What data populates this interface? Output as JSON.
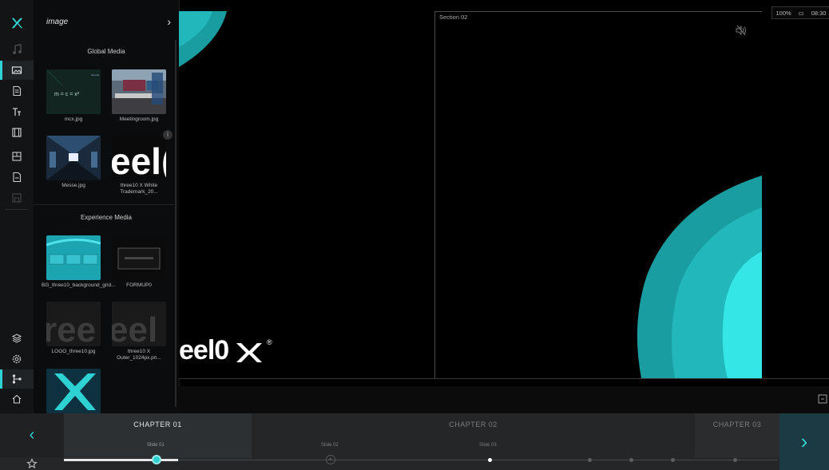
{
  "rail": {
    "logo": "x-logo",
    "icons": [
      "music-icon",
      "image-icon",
      "document-icon",
      "text-icon",
      "video-icon",
      "layout-icon",
      "file-icon",
      "save-icon"
    ],
    "bottom_icons": [
      "layers-icon",
      "settings-icon",
      "flow-icon",
      "home-icon"
    ]
  },
  "panel": {
    "title": "image",
    "global_title": "Global Media",
    "global_items": [
      {
        "label": "mcx.jpg"
      },
      {
        "label": "Meetingroom.jpg"
      },
      {
        "label": "Messe.jpg"
      },
      {
        "label": "three10 X White Trademark_20..."
      }
    ],
    "experience_title": "Experience Media",
    "experience_items": [
      {
        "label": "BG_three10_background_grid..."
      },
      {
        "label": "FORMUP0"
      },
      {
        "label": "LOGO_three10.jpg"
      },
      {
        "label": "three10 X Outer_1024px.pn..."
      }
    ]
  },
  "stage": {
    "section_label": "Section 02",
    "brand_text": "eel0",
    "trademark": "®"
  },
  "status": {
    "battery": "100%",
    "time": "08:30"
  },
  "timeline": {
    "chapters": [
      "CHAPTER 01",
      "CHAPTER 02",
      "CHAPTER 03"
    ],
    "slides": [
      "Slide 01",
      "Slide 02",
      "Slide 03"
    ],
    "progress": 0.16
  },
  "colors": {
    "accent": "#2fd2d2",
    "teal_dark": "#1a9da0",
    "teal_mid": "#22b8bb",
    "teal_light": "#35e6e6"
  }
}
